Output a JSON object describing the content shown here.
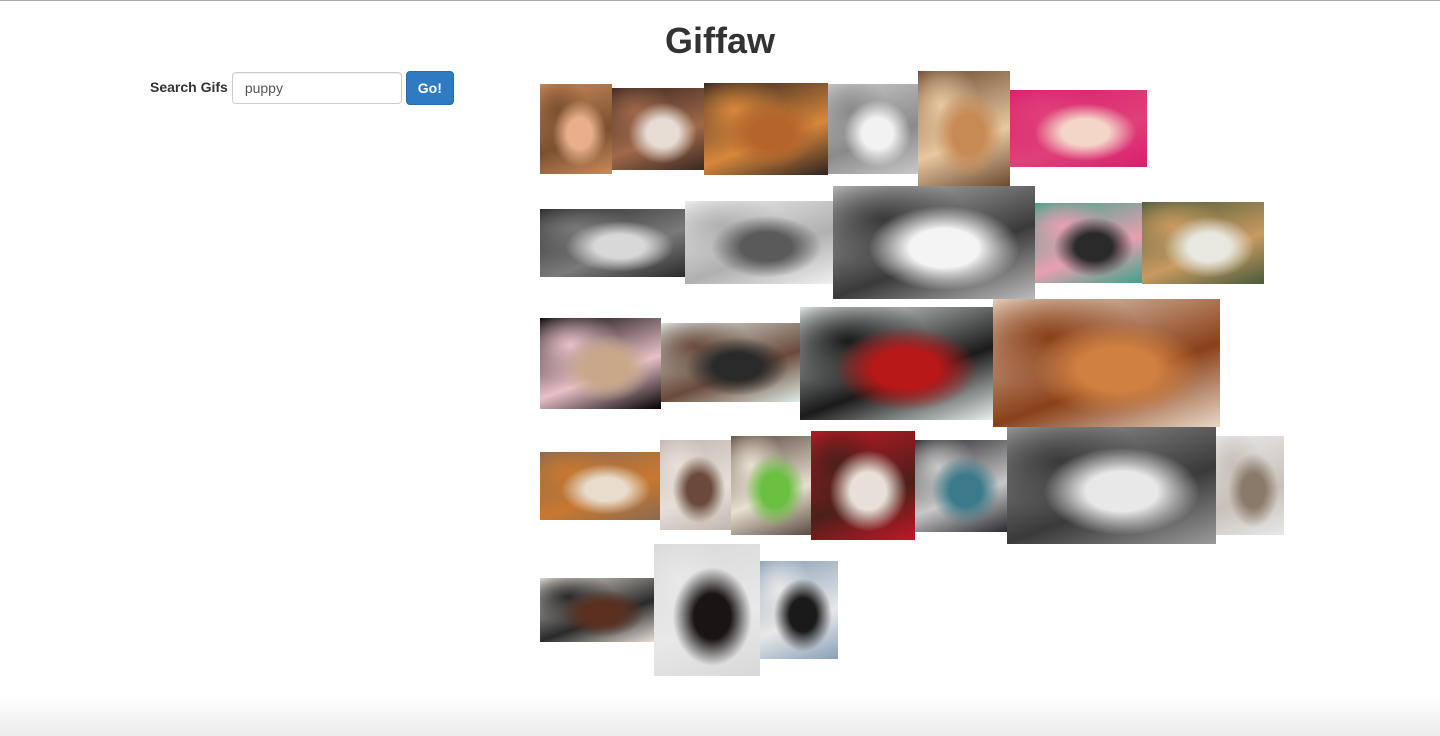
{
  "app": {
    "title": "Giffaw"
  },
  "search": {
    "label": "Search Gifs",
    "value": "puppy",
    "button_label": "Go!"
  },
  "accent_color": "#2f7bc1",
  "gifs": [
    {
      "name": "gif-puppy-1",
      "colors": [
        "#c98a5a",
        "#e8b08a",
        "#7a5030"
      ]
    },
    {
      "name": "gif-puppy-2",
      "colors": [
        "#3a2820",
        "#e7dcd3",
        "#a0684a"
      ]
    },
    {
      "name": "gif-puppy-3",
      "colors": [
        "#2c2420",
        "#b5652b",
        "#d8873c"
      ]
    },
    {
      "name": "gif-puppy-4",
      "colors": [
        "#c8c8c8",
        "#f2f2f2",
        "#8a8a8a"
      ]
    },
    {
      "name": "gif-puppy-5",
      "colors": [
        "#6b4a30",
        "#c88a55",
        "#e8c8a0"
      ]
    },
    {
      "name": "gif-puppy-6",
      "colors": [
        "#d81e6e",
        "#f4d6c8",
        "#e0407a"
      ]
    },
    {
      "name": "gif-puppy-7",
      "colors": [
        "#2a2a2a",
        "#d8d8d8",
        "#7a7a7a"
      ]
    },
    {
      "name": "gif-puppy-8",
      "colors": [
        "#f0f0f0",
        "#5a5a5a",
        "#b0b0b0"
      ]
    },
    {
      "name": "gif-puppy-9",
      "colors": [
        "#bcbcbc",
        "#f4f4f4",
        "#3a3a3a"
      ]
    },
    {
      "name": "gif-puppy-10",
      "colors": [
        "#3fa38a",
        "#2a2a2a",
        "#e8a0b0"
      ]
    },
    {
      "name": "gif-puppy-11",
      "colors": [
        "#4a5a3a",
        "#e8e8e0",
        "#c89a60"
      ]
    },
    {
      "name": "gif-puppy-12",
      "colors": [
        "#000000",
        "#c8a888",
        "#e8c0c8"
      ]
    },
    {
      "name": "gif-puppy-13",
      "colors": [
        "#e0ece8",
        "#2a2a2a",
        "#6a4a3a"
      ]
    },
    {
      "name": "gif-puppy-14",
      "colors": [
        "#e8f0ee",
        "#b81818",
        "#1a1a1a"
      ]
    },
    {
      "name": "gif-puppy-15",
      "colors": [
        "#e8d8c8",
        "#d08040",
        "#8a4018"
      ]
    },
    {
      "name": "gif-puppy-16",
      "colors": [
        "#8a6a50",
        "#e8dccc",
        "#c87830"
      ]
    },
    {
      "name": "gif-puppy-17",
      "colors": [
        "#c0b8b0",
        "#6a4a3a",
        "#e8e0d8"
      ]
    },
    {
      "name": "gif-puppy-18",
      "colors": [
        "#5a4a40",
        "#6ac040",
        "#e8e0d0"
      ]
    },
    {
      "name": "gif-puppy-19",
      "colors": [
        "#c01828",
        "#e8e0d8",
        "#4a2018"
      ]
    },
    {
      "name": "gif-puppy-20",
      "colors": [
        "#2a2a30",
        "#3a7a8a",
        "#c8c8c8"
      ]
    },
    {
      "name": "gif-puppy-21",
      "colors": [
        "#9a9a9a",
        "#e8e8e8",
        "#3a3a3a"
      ]
    },
    {
      "name": "gif-puppy-22",
      "colors": [
        "#e8e8e8",
        "#8a7a6a",
        "#c8c0b8"
      ]
    },
    {
      "name": "gif-puppy-23",
      "colors": [
        "#e8e0d8",
        "#5a3020",
        "#2a2a2a"
      ]
    },
    {
      "name": "gif-puppy-24",
      "colors": [
        "#d8d8d8",
        "#1a1414",
        "#e8e8e8"
      ]
    },
    {
      "name": "gif-puppy-25",
      "colors": [
        "#8aa0b8",
        "#1a1a1a",
        "#e8e8e8"
      ]
    }
  ]
}
